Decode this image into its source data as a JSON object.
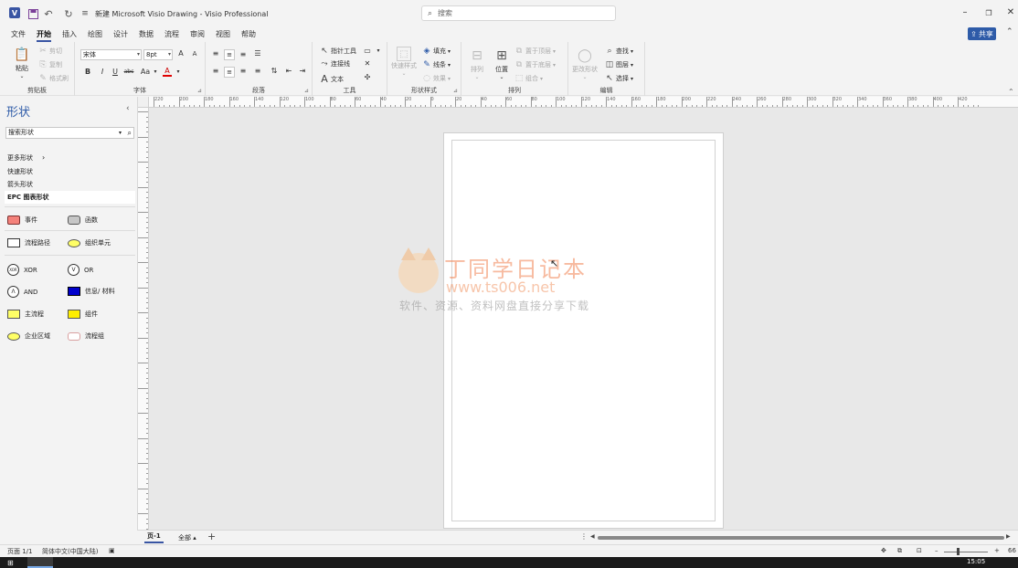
{
  "titlebar": {
    "title": "新建 Microsoft Visio Drawing  -  Visio Professional",
    "search_placeholder": "搜索",
    "app_logo": "V"
  },
  "tabs": [
    {
      "label": "文件"
    },
    {
      "label": "开始",
      "active": true
    },
    {
      "label": "插入"
    },
    {
      "label": "绘图"
    },
    {
      "label": "设计"
    },
    {
      "label": "数据"
    },
    {
      "label": "流程"
    },
    {
      "label": "审阅"
    },
    {
      "label": "视图"
    },
    {
      "label": "帮助"
    }
  ],
  "share_label": "共享",
  "ribbon": {
    "clipboard": {
      "label": "剪贴板",
      "paste": "粘贴",
      "cut": "剪切",
      "copy": "复制",
      "format_painter": "格式刷"
    },
    "font": {
      "label": "字体",
      "font_name": "宋体",
      "font_size": "8pt",
      "bold": "B",
      "italic": "I",
      "underline": "U",
      "strike": "abc",
      "case": "Aa",
      "grow": "A",
      "shrink": "A",
      "color": "A"
    },
    "paragraph": {
      "label": "段落"
    },
    "tools": {
      "label": "工具",
      "pointer": "指针工具",
      "connector": "连接线",
      "text": "文本",
      "text_icon": "A"
    },
    "shape_styles": {
      "label": "形状样式",
      "quick_styles": "快速样式",
      "fill": "填充",
      "line": "线条",
      "effects": "效果"
    },
    "arrange": {
      "label": "排列",
      "align": "排列",
      "position": "位置",
      "bring_front": "置于顶层",
      "send_back": "置于底层",
      "group": "组合"
    },
    "editing": {
      "label": "编辑",
      "change_shape": "更改形状",
      "find": "查找",
      "layers": "图层",
      "select": "选择"
    }
  },
  "hruler_labels": [
    "220",
    "200",
    "180",
    "160",
    "140",
    "120",
    "100",
    "80",
    "60",
    "40",
    "20",
    "0",
    "20",
    "40",
    "60",
    "80",
    "100",
    "120",
    "140",
    "160",
    "180",
    "200",
    "220",
    "240",
    "260",
    "280",
    "300",
    "320",
    "340",
    "360",
    "380",
    "400",
    "420"
  ],
  "shapes_pane": {
    "title": "形状",
    "search_placeholder": "搜索形状",
    "more_shapes": "更多形状",
    "quick_shapes": "快速形状",
    "arrow_shapes": "箭头形状",
    "stencil": "EPC 图表形状",
    "items": [
      {
        "label": "事件",
        "swatch": "event"
      },
      {
        "label": "函数",
        "swatch": "function"
      },
      {
        "label": "流程路径",
        "swatch": "process-path"
      },
      {
        "label": "组织单元",
        "swatch": "org-unit"
      },
      {
        "label": "XOR",
        "swatch": "xor",
        "symbol": "XOR"
      },
      {
        "label": "OR",
        "swatch": "or",
        "symbol": "V"
      },
      {
        "label": "AND",
        "swatch": "and",
        "symbol": "Λ"
      },
      {
        "label": "信息/ 材料",
        "swatch": "info"
      },
      {
        "label": "主流程",
        "swatch": "main-process"
      },
      {
        "label": "组件",
        "swatch": "component"
      },
      {
        "label": "企业区域",
        "swatch": "enterprise-area"
      },
      {
        "label": "流程组",
        "swatch": "process-group"
      }
    ]
  },
  "watermark": {
    "title": "丁同学日记本",
    "url": "www.ts006.net",
    "tagline": "软件、资源、资料网盘直接分享下载"
  },
  "pagebar": {
    "page_tab": "页-1",
    "all_pages": "全部 ▴",
    "add": "+"
  },
  "statusbar": {
    "page_info": "页面 1/1",
    "language": "简体中文(中国大陆)",
    "zoom_text": "66"
  },
  "taskbar": {
    "clock": "15:05"
  },
  "colors": {
    "accent": "#3955a3",
    "share": "#2e5ba8",
    "event": "#f4817a",
    "function": "#c6c6c6",
    "info": "#0000cc",
    "yellow": "#ffff66",
    "main_process": "#ffee00"
  }
}
